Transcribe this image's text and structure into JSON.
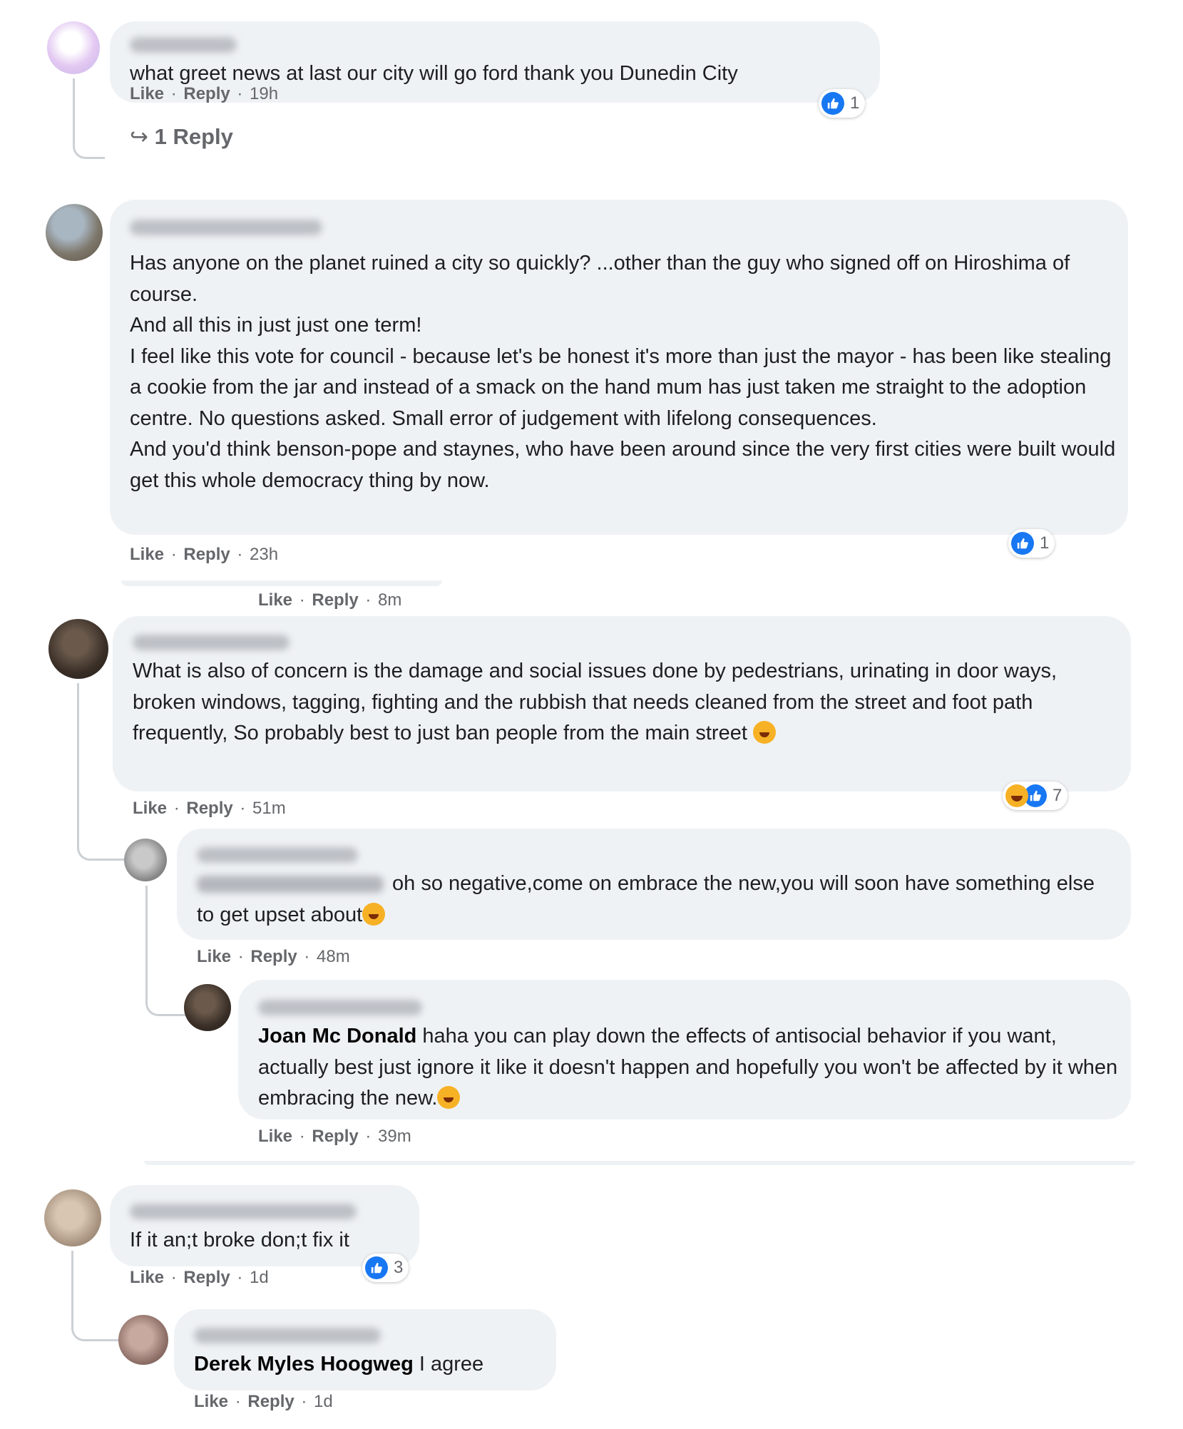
{
  "labels": {
    "like": "Like",
    "reply": "Reply",
    "sep": " · "
  },
  "colors": {
    "bubble": "#eff2f5",
    "like_blue": "#1877f2",
    "meta_gray": "#65676b"
  },
  "icons": [
    "reply-arrow-icon",
    "like-reaction-icon",
    "haha-reaction-icon",
    "laughing-emoji-icon",
    "winking-emoji-icon"
  ],
  "comments": {
    "c1": {
      "text": "what greet news at last our city will go ford thank you Dunedin City",
      "time": "19h",
      "reactions": "1",
      "replies_link": "1 Reply"
    },
    "c2": {
      "lines": [
        "Has anyone on the planet ruined a city so quickly? ...other than the guy who signed off on Hiroshima of course.",
        "And all this in just just one term!",
        "I feel like this vote for council - because let's be honest it's more than just the mayor - has been like stealing a cookie from the jar and instead of a smack on the hand mum has just taken me straight to the adoption centre. No questions asked. Small error of judgement with lifelong consequences.",
        "And you'd think benson-pope and staynes, who have been around since the very first cities were built would get this whole democracy thing by now."
      ],
      "time": "23h",
      "reactions": "1"
    },
    "c3_prev_time": "8m",
    "c3": {
      "text": "What is also of concern is the damage and social issues done by pedestrians, urinating in door ways, broken windows, tagging, fighting and the rubbish that needs cleaned from the street and foot path frequently, So probably best to just ban people from the main street",
      "time": "51m",
      "reactions": "7"
    },
    "c3r1": {
      "text": "oh so negative,come on embrace the new,you will soon have something else to get upset about",
      "time": "48m"
    },
    "c3r2": {
      "mention": "Joan Mc Donald",
      "text": "haha you can play down the effects of antisocial behavior if you want, actually best just ignore it like it doesn't happen and hopefully you won't be affected by it when embracing the new.",
      "time": "39m"
    },
    "c4": {
      "text": "If it an;t broke don;t fix it",
      "time": "1d",
      "reactions": "3"
    },
    "c4r1": {
      "mention": "Derek Myles Hoogweg",
      "text": "I agree",
      "time": "1d"
    }
  }
}
